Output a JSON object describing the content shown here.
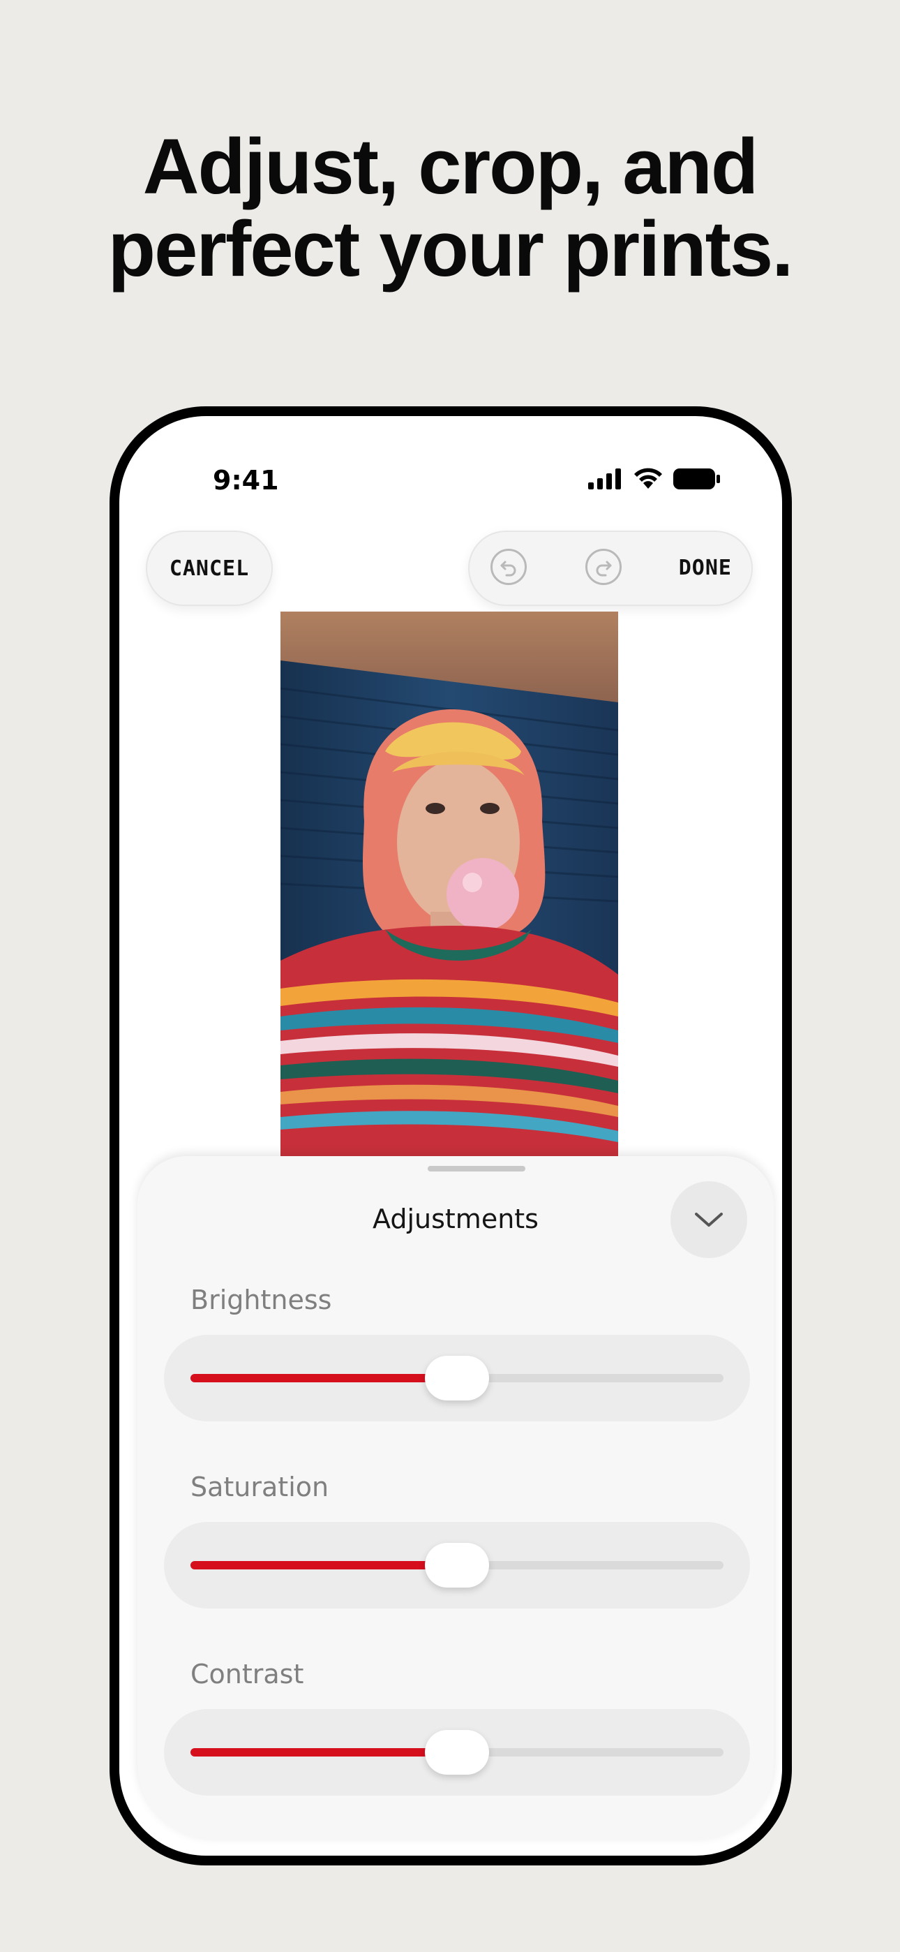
{
  "headline": {
    "line1": "Adjust, crop, and",
    "line2": "perfect your prints."
  },
  "status_bar": {
    "time": "9:41",
    "icons": [
      "signal-icon",
      "wifi-icon",
      "battery-icon"
    ]
  },
  "toolbar": {
    "cancel_label": "CANCEL",
    "undo_icon": "undo-icon",
    "redo_icon": "redo-icon",
    "done_label": "DONE"
  },
  "photo": {
    "description_icon": "portrait-photo"
  },
  "adjustments": {
    "title": "Adjustments",
    "collapse_icon": "chevron-down-icon",
    "sliders": [
      {
        "label": "Brightness",
        "value": 0.5
      },
      {
        "label": "Saturation",
        "value": 0.5
      },
      {
        "label": "Contrast",
        "value": 0.5
      }
    ]
  },
  "colors": {
    "accent": "#D60F1D",
    "background": "#ECEBE8"
  }
}
